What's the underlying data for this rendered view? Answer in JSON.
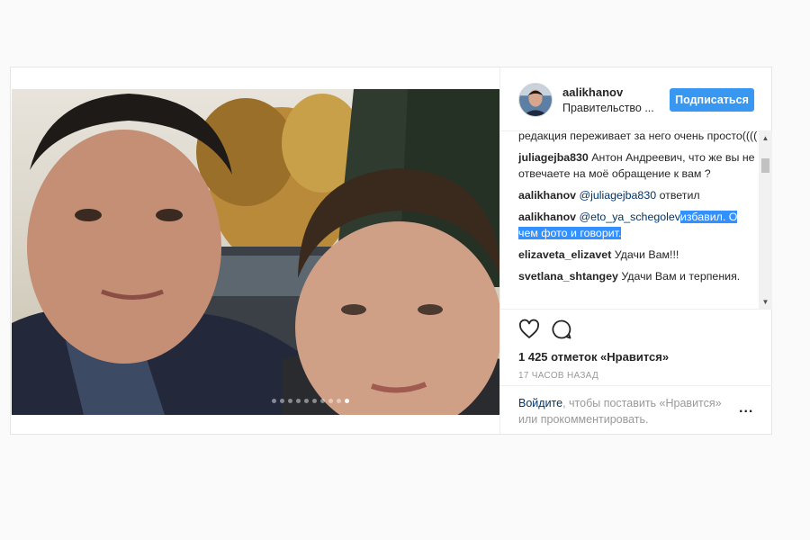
{
  "post": {
    "carousel": {
      "count": 10,
      "active_index": 9
    }
  },
  "header": {
    "username": "aalikhanov",
    "location": "Правительство ...",
    "follow_label": "Подписаться"
  },
  "comments": [
    {
      "user": "",
      "text": "редакция переживает за него очень просто(((("
    },
    {
      "user": "juliagejba830",
      "text": "Антон Андреевич, что же вы не отвечаете на моё обращение к вам ?"
    },
    {
      "user": "aalikhanov",
      "mention": "@juliagejba830",
      "text": "ответил"
    },
    {
      "user": "aalikhanov",
      "mention": "@eto_ya_schegolev",
      "text_highlighted": "избавил. О чем фото и говорит."
    },
    {
      "user": "elizaveta_elizavet",
      "text": "Удачи Вам!!!"
    },
    {
      "user": "svetlana_shtangey",
      "text": "Удачи Вам и терпения."
    }
  ],
  "scrollbar": {
    "up_arrow": "▲",
    "down_arrow": "▼"
  },
  "actions": {
    "like_icon": "heart-icon",
    "comment_icon": "comment-icon",
    "likes_text": "1 425 отметок «Нравится»",
    "time_text": "17 ЧАСОВ НАЗАД"
  },
  "login": {
    "link_text": "Войдите",
    "rest_text": ", чтобы поставить «Нравится» или прокомментировать.",
    "more_label": "..."
  },
  "colors": {
    "accent": "#3897f0",
    "link": "#003569",
    "selection": "#3390ff"
  }
}
